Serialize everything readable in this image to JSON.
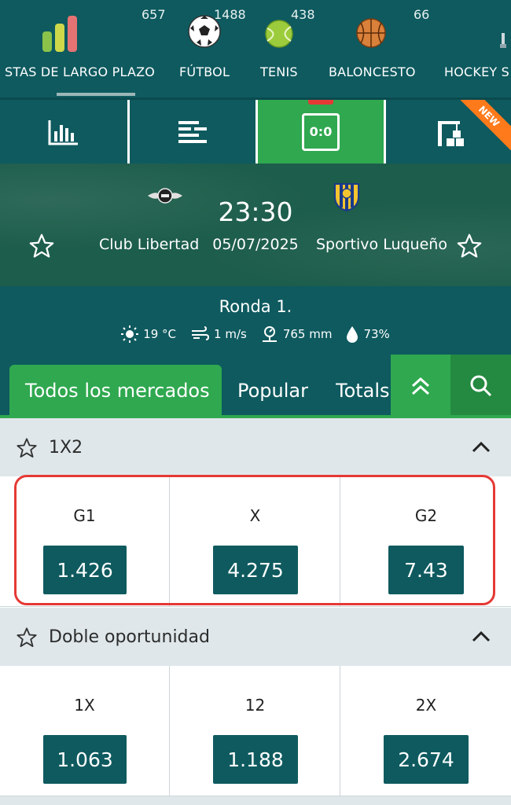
{
  "sports_nav": {
    "items": [
      {
        "label": "STAS DE LARGO PLAZO",
        "count": "657",
        "icon": "bar-chart-icon"
      },
      {
        "label": "FÚTBOL",
        "count": "1488",
        "icon": "soccer-ball-icon"
      },
      {
        "label": "TENIS",
        "count": "438",
        "icon": "tennis-ball-icon"
      },
      {
        "label": "BALONCESTO",
        "count": "66",
        "icon": "basketball-icon"
      },
      {
        "label": "HOCKEY S",
        "count": "",
        "icon": "hockey-icon"
      }
    ]
  },
  "toolbar": {
    "score_label": "0:0",
    "new_badge": "NEW"
  },
  "match": {
    "home_team": "Club Libertad",
    "away_team": "Sportivo Luqueño",
    "time": "23:30",
    "date": "05/07/2025"
  },
  "round": {
    "title": "Ronda 1.",
    "temperature": "19 °C",
    "wind": "1 m/s",
    "pressure": "765 mm",
    "humidity": "73%"
  },
  "market_tabs": [
    "Todos los mercados",
    "Popular",
    "Totals"
  ],
  "markets": [
    {
      "name": "1X2",
      "outcomes": [
        {
          "label": "G1",
          "odd": "1.426"
        },
        {
          "label": "X",
          "odd": "4.275"
        },
        {
          "label": "G2",
          "odd": "7.43"
        }
      ]
    },
    {
      "name": "Doble oportunidad",
      "outcomes": [
        {
          "label": "1X",
          "odd": "1.063"
        },
        {
          "label": "12",
          "odd": "1.188"
        },
        {
          "label": "2X",
          "odd": "2.674"
        }
      ]
    }
  ],
  "colors": {
    "primary": "#0e5a5f",
    "accent": "#2fa84f",
    "highlight": "#e53935",
    "new_badge": "#ff7a1a"
  }
}
